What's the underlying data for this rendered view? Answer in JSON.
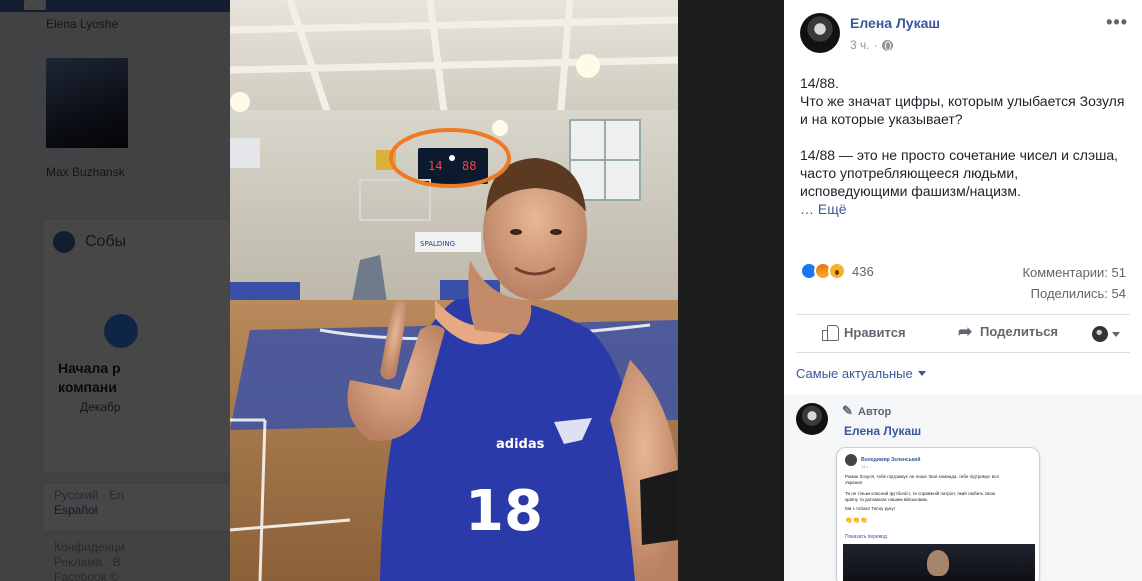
{
  "background": {
    "name": "Elena Lyoshe",
    "person_name": "Max Buzhansk",
    "section": "Собы",
    "event_line1": "Начала р",
    "event_line2": "компани",
    "event_date": "Декабр",
    "lang_line1": "Русский · En",
    "lang_line2": "Español",
    "footer1": "Конфиденци",
    "footer2": "Реклама · В",
    "footer3": "Facebook ©"
  },
  "photo": {
    "scoreboard": {
      "home": "14",
      "away": "88"
    },
    "banner": "SPALDING",
    "jersey": {
      "number": "18",
      "brand": "adidas"
    },
    "highlight_color": "#f07a22"
  },
  "post": {
    "author": "Елена Лукаш",
    "time": "3 ч.",
    "separator": "·",
    "more": "•••",
    "text_p1": "14/88.\nЧто же значат цифры, которым улыбается Зозуля\nи на которые указывает?",
    "text_p2": "14/88 — это не просто сочетание чисел и слэша,\nчасто употребляющееся людьми,\nисповедующими фашизм/нацизм.",
    "see_more": "… Ещё",
    "reaction_count": "436",
    "comments": "Комментарии: 51",
    "shares": "Поделились: 54",
    "like_label": "Нравится",
    "share_label": "Поделиться",
    "sort_label": "Самые актуальные",
    "colors": {
      "link": "#385898",
      "like_blue": "#1877f2"
    }
  },
  "comment": {
    "badge": "Автор",
    "author": "Елена Лукаш",
    "screenshot": {
      "name": "Володимир Зеленський",
      "time": "14 г. ·",
      "line1": "Роман Зозуля, тебе підтримує не лише твоя команда, тебе підтримує вся",
      "line2": "Україна!",
      "line3": "Ти не тільки класний футболіст, ти справжній патріот, який любить свою",
      "line4": "країну та допомагає нашим військовим.",
      "line5": "Ми з тобою! Тисну руку!",
      "emoji": "👏👏👏",
      "translate": "Показать перевод"
    }
  }
}
